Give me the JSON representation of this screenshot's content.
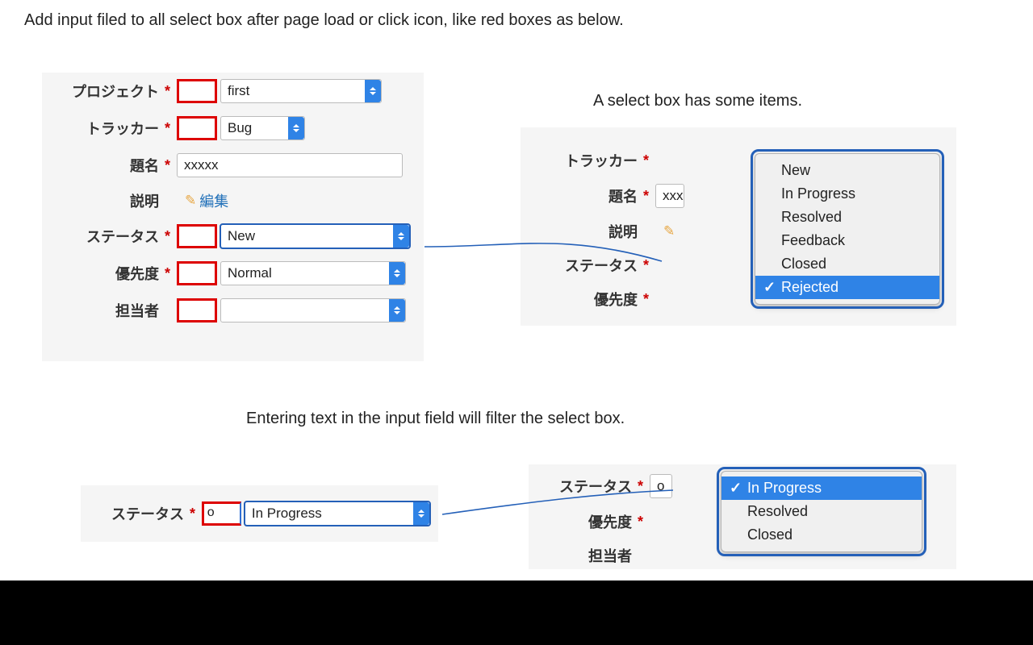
{
  "captions": {
    "top": "Add input filed to all select box after page load or click icon, like red boxes as below.",
    "midR": "A select box has some items.",
    "mid": "Entering text in the input field will filter the select box."
  },
  "panelA": {
    "project": {
      "label": "プロジェクト",
      "req": "*",
      "filter": "",
      "value": "first"
    },
    "tracker": {
      "label": "トラッカー",
      "req": "*",
      "filter": "",
      "value": "Bug"
    },
    "subject": {
      "label": "題名",
      "req": "*",
      "value": "xxxxx"
    },
    "desc": {
      "label": "説明",
      "editlink": "編集"
    },
    "status": {
      "label": "ステータス",
      "req": "*",
      "filter": "",
      "value": "New"
    },
    "priority": {
      "label": "優先度",
      "req": "*",
      "filter": "",
      "value": "Normal"
    },
    "assignee": {
      "label": "担当者",
      "filter": "",
      "value": ""
    }
  },
  "panelB": {
    "tracker": {
      "label": "トラッカー",
      "req": "*"
    },
    "subject": {
      "label": "題名",
      "req": "*",
      "value": "xxx"
    },
    "desc": {
      "label": "説明"
    },
    "status": {
      "label": "ステータス",
      "req": "*"
    },
    "priority": {
      "label": "優先度",
      "req": "*"
    },
    "dropdown": [
      "New",
      "In Progress",
      "Resolved",
      "Feedback",
      "Closed",
      "Rejected"
    ],
    "dropdown_selected_idx": 5
  },
  "panelC": {
    "status": {
      "label": "ステータス",
      "req": "*",
      "filter": "o",
      "value": "In Progress"
    }
  },
  "panelD": {
    "status": {
      "label": "ステータス",
      "req": "*",
      "filter": "o"
    },
    "priority": {
      "label": "優先度",
      "req": "*"
    },
    "assignee": {
      "label": "担当者"
    },
    "dropdown": [
      "In Progress",
      "Resolved",
      "Closed"
    ],
    "dropdown_selected_idx": 0
  }
}
